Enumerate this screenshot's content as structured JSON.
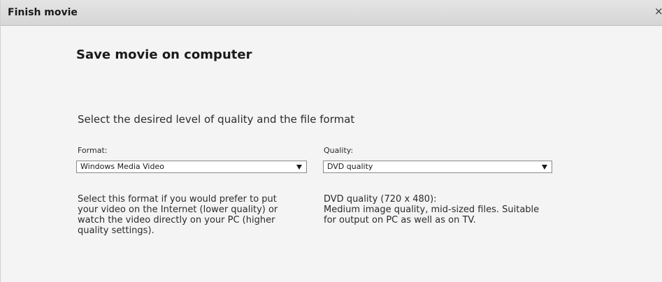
{
  "window": {
    "title": "Finish movie",
    "close_glyph": "×",
    "close_icon": "close-icon"
  },
  "main": {
    "heading": "Save movie on computer",
    "instruction": "Select the desired level of quality and the file format"
  },
  "format": {
    "label": "Format:",
    "selected": "Windows Media Video",
    "description": "Select this format if you would prefer to put\nyour video on the Internet (lower quality) or\nwatch the video directly on your PC (higher\nquality settings).",
    "dropdown_icon": "chevron-down-icon"
  },
  "quality": {
    "label": "Quality:",
    "selected": "DVD quality",
    "description": "DVD quality (720 x 480):\nMedium image quality, mid-sized files. Suitable\nfor output on PC as well as on TV.",
    "dropdown_icon": "chevron-down-icon"
  }
}
